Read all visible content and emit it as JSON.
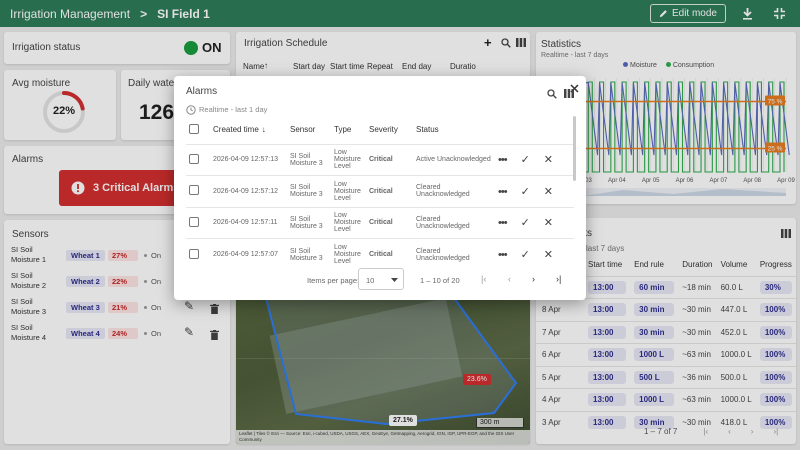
{
  "header": {
    "app_title": "Irrigation Management",
    "separator": ">",
    "field_name": "SI Field 1",
    "edit_label": "Edit mode"
  },
  "status": {
    "title": "Irrigation status",
    "value": "ON",
    "color": "#1a9c3e"
  },
  "avg_moisture": {
    "title": "Avg moisture",
    "value": "22%",
    "percent": 22
  },
  "daily_water": {
    "title": "Daily water c",
    "value": "126"
  },
  "alarms_card": {
    "title": "Alarms",
    "badge": "3 Critical Alarms",
    "badge_color": "#d32f2f"
  },
  "sensors": {
    "title": "Sensors",
    "items": [
      {
        "name": "SI Soil Moisture 1",
        "zone": "Wheat 1",
        "pct": "27%",
        "state": "On"
      },
      {
        "name": "SI Soil Moisture 2",
        "zone": "Wheat 2",
        "pct": "22%",
        "state": "On"
      },
      {
        "name": "SI Soil Moisture 3",
        "zone": "Wheat 3",
        "pct": "21%",
        "state": "On"
      },
      {
        "name": "SI Soil Moisture 4",
        "zone": "Wheat 4",
        "pct": "24%",
        "state": "On"
      }
    ]
  },
  "schedule": {
    "title": "Irrigation Schedule",
    "columns": [
      "Name",
      "Start day",
      "Start time",
      "Repeat",
      "End day",
      "Duratio"
    ]
  },
  "statistics": {
    "title": "Statistics",
    "subtitle": "Realtime - last 7 days",
    "legend": [
      "Moisture",
      "Consumption"
    ]
  },
  "chart_data": {
    "type": "line",
    "x": [
      "Apr 03",
      "Apr 04",
      "Apr 05",
      "Apr 06",
      "Apr 07",
      "Apr 08",
      "Apr 09"
    ],
    "series": [
      {
        "name": "Moisture",
        "color": "#5c6bc0"
      },
      {
        "name": "Consumption",
        "color": "#2eae4f"
      }
    ],
    "thresholds": [
      {
        "label": "75 %",
        "value": 75,
        "color": "#e67e22"
      },
      {
        "label": "25 %",
        "value": 25,
        "color": "#e67e22"
      }
    ]
  },
  "map": {
    "labels": [
      "23.6%",
      "27.1%"
    ],
    "scale": "300 m",
    "attribution": "Leaflet | Tiles © Esri — Source: Esri, i-cubed, USDA, USGS, AEX, GeoEye, Getmapping, Aerogrid, IGN, IGP, UPR-EGP, and the GIS User Community"
  },
  "tasks": {
    "title_suffix": "sks",
    "subtitle_suffix": "last 7 days",
    "columns": [
      "Start time",
      "End rule",
      "Duration",
      "Volume",
      "Progress"
    ],
    "rows": [
      {
        "day": "",
        "start": "13:00",
        "rule": "60 min",
        "duration": "~18 min",
        "volume": "60.0 L",
        "progress": "30%"
      },
      {
        "day": "8 Apr",
        "start": "13:00",
        "rule": "30 min",
        "duration": "~30 min",
        "volume": "447.0 L",
        "progress": "100%"
      },
      {
        "day": "7 Apr",
        "start": "13:00",
        "rule": "30 min",
        "duration": "~30 min",
        "volume": "452.0 L",
        "progress": "100%"
      },
      {
        "day": "6 Apr",
        "start": "13:00",
        "rule": "1000 L",
        "duration": "~63 min",
        "volume": "1000.0 L",
        "progress": "100%"
      },
      {
        "day": "5 Apr",
        "start": "13:00",
        "rule": "500 L",
        "duration": "~36 min",
        "volume": "500.0 L",
        "progress": "100%"
      },
      {
        "day": "4 Apr",
        "start": "13:00",
        "rule": "1000 L",
        "duration": "~63 min",
        "volume": "1000.0 L",
        "progress": "100%"
      },
      {
        "day": "3 Apr",
        "start": "13:00",
        "rule": "30 min",
        "duration": "~30 min",
        "volume": "418.0 L",
        "progress": "100%"
      }
    ],
    "pagination": "1 – 7 of 7"
  },
  "modal": {
    "title": "Alarms",
    "subtitle": "Realtime - last 1 day",
    "columns": [
      "Created time",
      "Sensor",
      "Type",
      "Severity",
      "Status"
    ],
    "rows": [
      {
        "time": "2026-04-09 12:57:13",
        "sensor": "SI Soil Moisture 3",
        "type": "Low Moisture Level",
        "severity": "Critical",
        "status": "Active Unacknowledged"
      },
      {
        "time": "2026-04-09 12:57:12",
        "sensor": "SI Soil Moisture 3",
        "type": "Low Moisture Level",
        "severity": "Critical",
        "status": "Cleared Unacknowledged"
      },
      {
        "time": "2026-04-09 12:57:11",
        "sensor": "SI Soil Moisture 3",
        "type": "Low Moisture Level",
        "severity": "Critical",
        "status": "Cleared Unacknowledged"
      },
      {
        "time": "2026-04-09 12:57:07",
        "sensor": "SI Soil Moisture 3",
        "type": "Low Moisture Level",
        "severity": "Critical",
        "status": "Cleared Unacknowledged"
      }
    ],
    "items_per_page_label": "Items per page:",
    "items_per_page": "10",
    "range": "1 – 10 of 20"
  }
}
